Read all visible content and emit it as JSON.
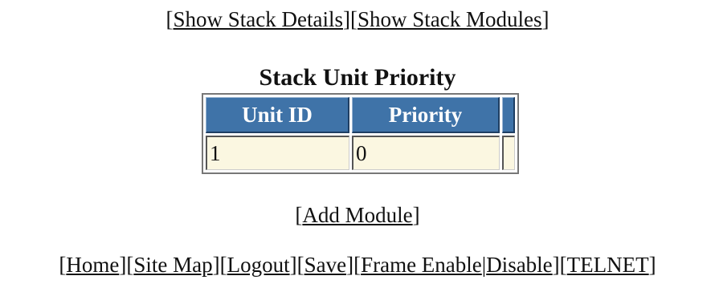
{
  "top_nav": {
    "show_stack_details": "Show Stack Details",
    "show_stack_modules": "Show Stack Modules"
  },
  "page_title": "Stack Unit Priority",
  "table": {
    "headers": [
      "Unit ID",
      "Priority",
      ""
    ],
    "rows": [
      {
        "unit_id": "1",
        "priority": "0",
        "extra": ""
      }
    ],
    "header_color": "#3f73a8",
    "cell_color": "#fbf7e1"
  },
  "add_module": "Add Module",
  "bottom_nav": {
    "home": "Home",
    "site_map": "Site Map",
    "logout": "Logout",
    "save": "Save",
    "frame_enable": "Frame Enable",
    "separator": "|",
    "disable": "Disable",
    "telnet": "TELNET"
  }
}
